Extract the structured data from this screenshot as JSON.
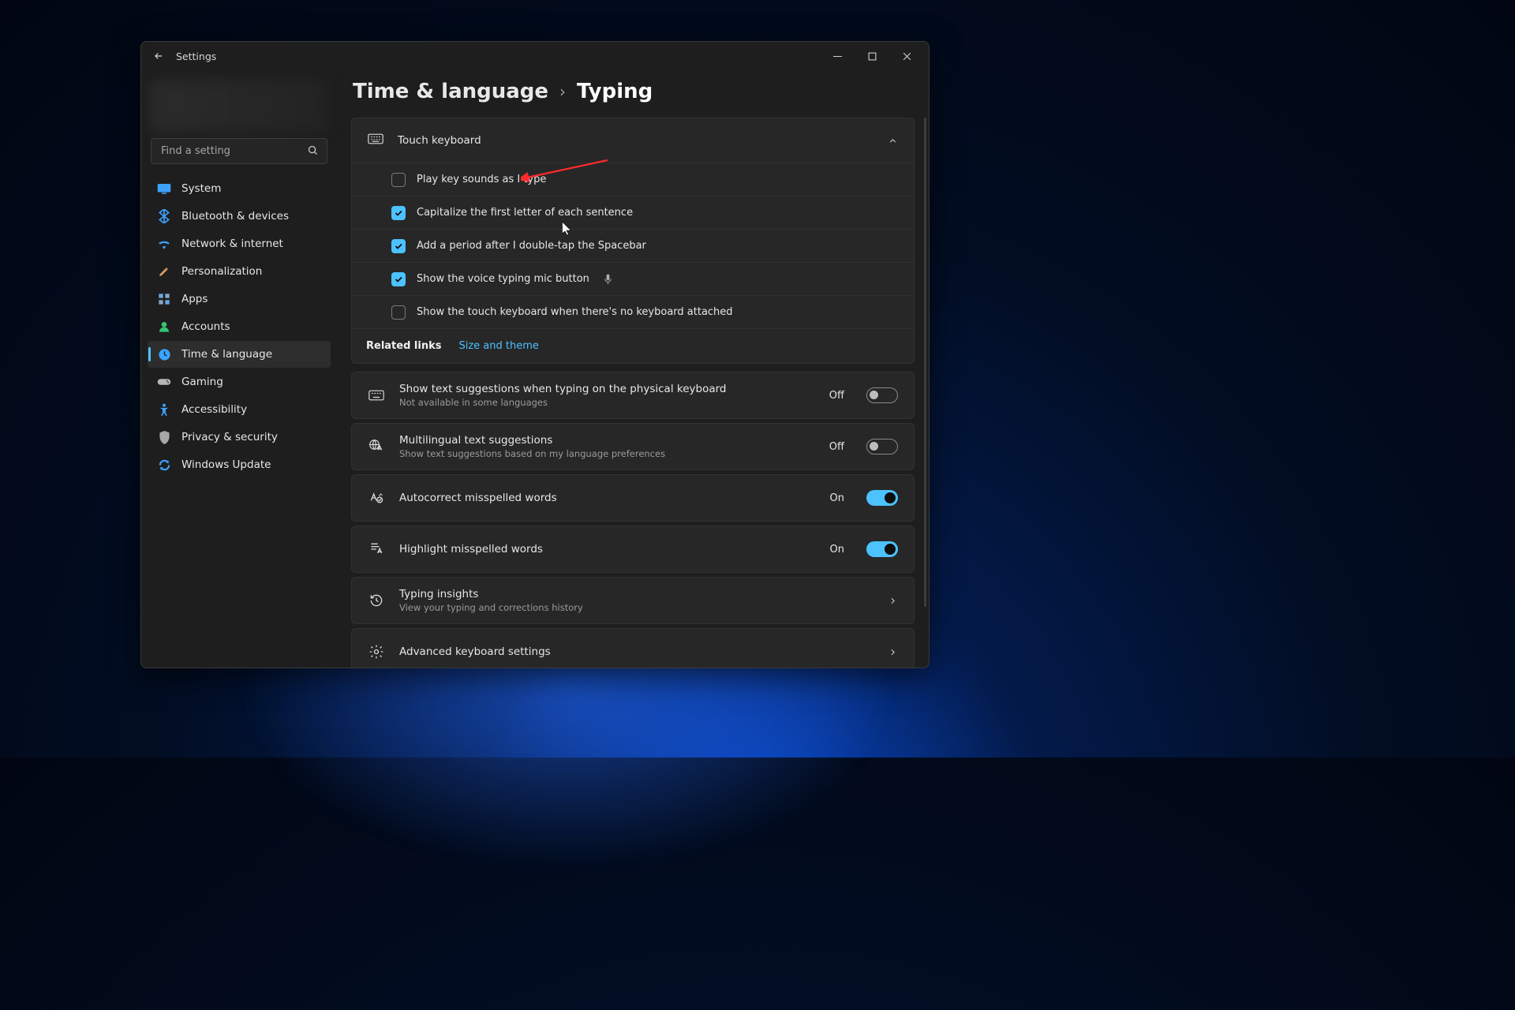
{
  "titlebar": {
    "app_name": "Settings"
  },
  "search": {
    "placeholder": "Find a setting"
  },
  "sidebar": {
    "items": [
      {
        "label": "System"
      },
      {
        "label": "Bluetooth & devices"
      },
      {
        "label": "Network & internet"
      },
      {
        "label": "Personalization"
      },
      {
        "label": "Apps"
      },
      {
        "label": "Accounts"
      },
      {
        "label": "Time & language"
      },
      {
        "label": "Gaming"
      },
      {
        "label": "Accessibility"
      },
      {
        "label": "Privacy & security"
      },
      {
        "label": "Windows Update"
      }
    ]
  },
  "breadcrumb": {
    "parent": "Time & language",
    "current": "Typing"
  },
  "touch_keyboard": {
    "title": "Touch keyboard",
    "options": [
      {
        "label": "Play key sounds as I type",
        "checked": false
      },
      {
        "label": "Capitalize the first letter of each sentence",
        "checked": true
      },
      {
        "label": "Add a period after I double-tap the Spacebar",
        "checked": true
      },
      {
        "label": "Show the voice typing mic button",
        "checked": true,
        "mic": true
      },
      {
        "label": "Show the touch keyboard when there's no keyboard attached",
        "checked": false
      }
    ]
  },
  "related": {
    "label": "Related links",
    "link": "Size and theme"
  },
  "settings": [
    {
      "title": "Show text suggestions when typing on the physical keyboard",
      "sub": "Not available in some languages",
      "state": "Off",
      "on": false
    },
    {
      "title": "Multilingual text suggestions",
      "sub": "Show text suggestions based on my language preferences",
      "state": "Off",
      "on": false
    },
    {
      "title": "Autocorrect misspelled words",
      "state": "On",
      "on": true
    },
    {
      "title": "Highlight misspelled words",
      "state": "On",
      "on": true
    }
  ],
  "nav_panels": [
    {
      "title": "Typing insights",
      "sub": "View your typing and corrections history"
    },
    {
      "title": "Advanced keyboard settings"
    }
  ]
}
